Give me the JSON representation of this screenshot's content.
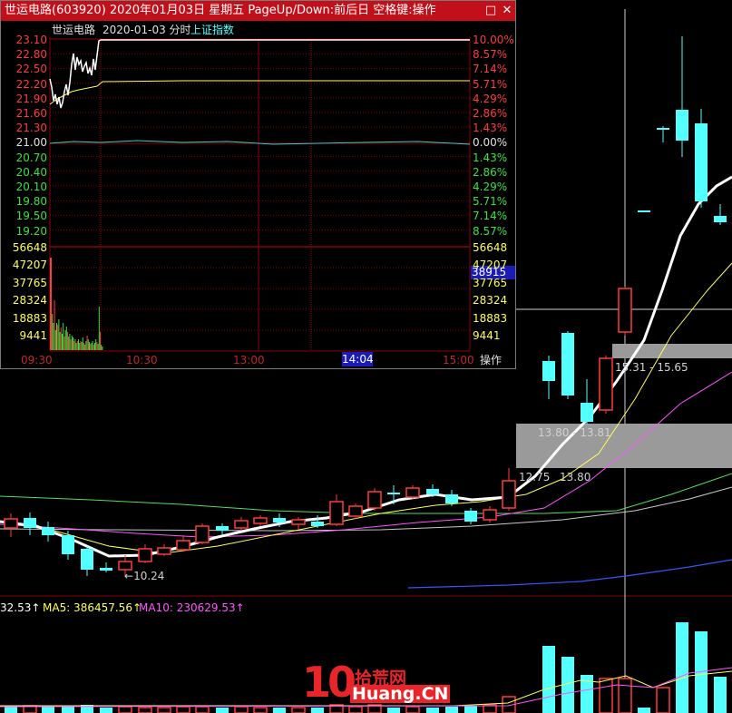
{
  "popup": {
    "title": "世运电路(603920) 2020年01月03日 星期五 PageUp/Down:前后日 空格键:操作",
    "minimize_glyph": "□",
    "close_glyph": "✕",
    "stock_name": "世运电路",
    "date_label": "2020-01-03 分时",
    "index_label": "上证指数",
    "price_axis": [
      "23.10",
      "22.80",
      "22.50",
      "22.20",
      "21.90",
      "21.60",
      "21.30",
      "21.00",
      "20.70",
      "20.40",
      "20.10",
      "19.80",
      "19.50",
      "19.20"
    ],
    "percent_axis": [
      "10.00%",
      "8.57%",
      "7.14%",
      "5.71%",
      "4.29%",
      "2.86%",
      "1.43%",
      "0.00%",
      "1.43%",
      "2.86%",
      "4.29%",
      "5.71%",
      "7.14%",
      "8.57%"
    ],
    "volume_axis_left": [
      "56648",
      "47207",
      "37765",
      "28324",
      "18883",
      "9441"
    ],
    "volume_axis_right": [
      "56648",
      "47207",
      "37765",
      "28324",
      "18883",
      "9441"
    ],
    "volume_cursor_value": "38915",
    "time_labels": [
      "09:30",
      "10:30",
      "13:00",
      "15:00"
    ],
    "time_cursor": "14:04",
    "operate_label": "操作"
  },
  "main_chart": {
    "price_annotations": {
      "low_marker": "10.24",
      "low_price": "12.75",
      "support_low": "13.80",
      "zone_lower": "13.80 - 13.81",
      "zone_upper": "15.31 - 15.65"
    },
    "volume_header": {
      "vol_fragment": "32.53↑",
      "ma5": "MA5: 386457.56↑",
      "ma10": "MA10: 230629.53↑"
    },
    "colors": {
      "up": "#ff3b3b",
      "down": "#54ffff",
      "ma_white": "#ffffff",
      "ma_yellow": "#ffff55",
      "ma_magenta": "#ff55ff",
      "ma_green": "#55ff55",
      "ma_blue": "#3355ff",
      "grid": "#8b0000"
    }
  },
  "watermark": {
    "number": "10",
    "site_cn": "拾荒网",
    "site_en": "Huang.CN"
  }
}
